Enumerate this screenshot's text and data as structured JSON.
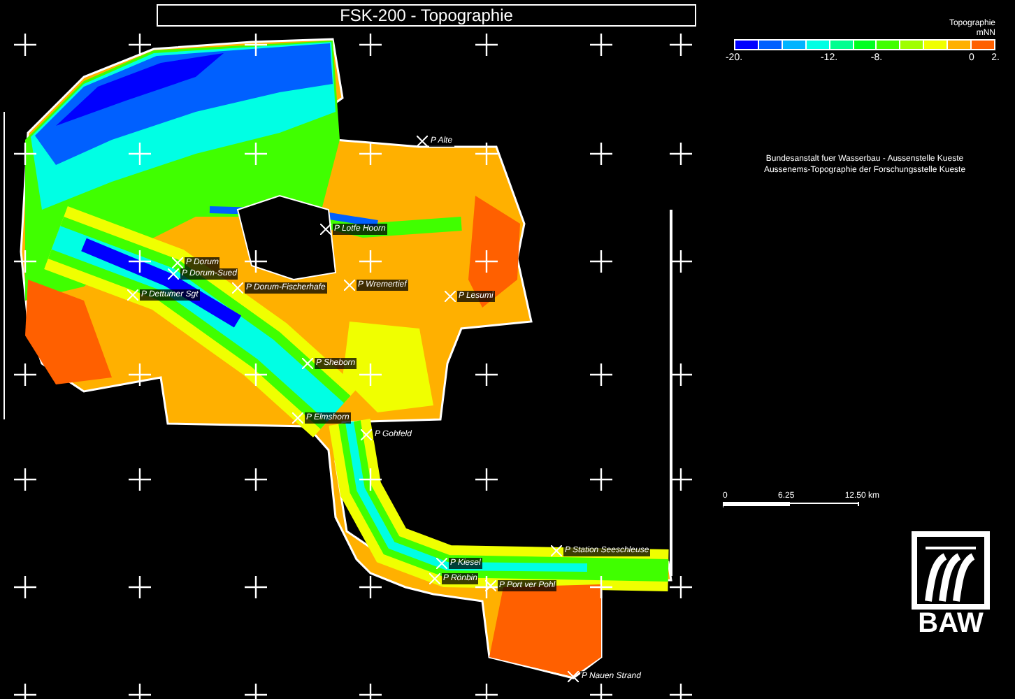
{
  "title": "FSK-200 - Topographie",
  "legend": {
    "title": "Topographie",
    "unit": "mNN",
    "swatches": [
      {
        "color": "#0000ff"
      },
      {
        "color": "#0060ff"
      },
      {
        "color": "#00b4ff"
      },
      {
        "color": "#00ffe4"
      },
      {
        "color": "#00ff90"
      },
      {
        "color": "#00ff20"
      },
      {
        "color": "#40ff00"
      },
      {
        "color": "#a0ff00"
      },
      {
        "color": "#f0ff00"
      },
      {
        "color": "#ffb000"
      },
      {
        "color": "#ff6000"
      }
    ],
    "ticks": [
      "-20.",
      "-12.",
      "-8.",
      "0",
      "2."
    ]
  },
  "description": [
    "Bundesanstalt fuer Wasserbau - Aussenstelle Kueste",
    "Aussenems-Topographie der Forschungsstelle Kueste"
  ],
  "scale_bar": {
    "labels": [
      "0",
      "6.25",
      "12.50 km"
    ]
  },
  "logo": {
    "text": "BAW"
  },
  "stations": [
    "P Alte",
    "P Lotfe Hoorn",
    "P Dorum",
    "P Dorum-Sued",
    "P Dettumer Sgt",
    "P Dorum-Fischerhafe",
    "P Wremertief",
    "P Lesumi",
    "P Sheborn",
    "P Elmshorn",
    "P Gohfeld",
    "P Station Seeschleuse",
    "P Kiesel",
    "P Rönbin",
    "P Port ver Pohl",
    "P Nauen Strand"
  ]
}
